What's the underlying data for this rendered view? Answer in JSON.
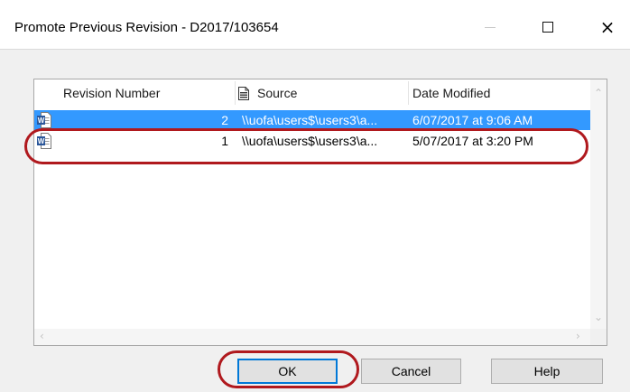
{
  "window": {
    "title": "Promote Previous Revision - D2017/103654",
    "controls": {
      "minimize": "minimize",
      "maximize": "maximize",
      "close": "×"
    }
  },
  "list": {
    "columns": [
      {
        "label": "Revision Number"
      },
      {
        "label": "Source",
        "icon": "document-icon"
      },
      {
        "label": "Date Modified"
      }
    ],
    "rows": [
      {
        "revision": "2",
        "source": "\\\\uofa\\users$\\users3\\a...",
        "date": "6/07/2017 at 9:06 AM",
        "selected": true,
        "icon": "word-document-icon"
      },
      {
        "revision": "1",
        "source": "\\\\uofa\\users$\\users3\\a...",
        "date": "5/07/2017 at 3:20 PM",
        "selected": false,
        "icon": "word-document-icon"
      }
    ]
  },
  "buttons": {
    "ok": "OK",
    "cancel": "Cancel",
    "help": "Help"
  },
  "colors": {
    "selection": "#3399ff",
    "annotation": "#b0191e",
    "default_button_border": "#0078d7"
  }
}
